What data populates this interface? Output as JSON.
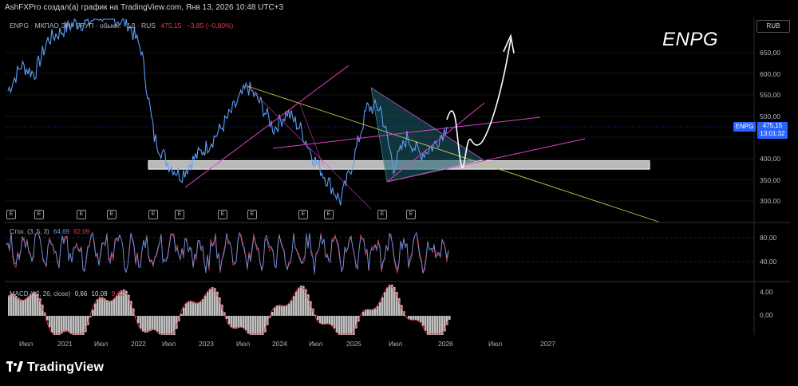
{
  "header": "AshFXPro создал(а) график на TradingView.com, Янв 13, 2026 10:48 UTC+3",
  "symbol_line": {
    "symbol": "ENPG · МКПАО ЭН+ ГРУП · обыкн. · 1Д · RUS",
    "price": "475,15",
    "change": "−3,85 (−0,80%)"
  },
  "big_title": "ENPG",
  "currency": "RUB",
  "price_label": {
    "symbol": "ENPG",
    "price": "475,15",
    "time": "13:01:32"
  },
  "stoch": {
    "name": "Стох. (3, 5, 3)",
    "k": "64,69",
    "d": "62,09",
    "ticks": [
      "80,00",
      "40,00"
    ]
  },
  "macd": {
    "name": "MACD (12, 26, close)",
    "v1": "0,66",
    "v2": "10,08",
    "v3": "9,42",
    "ticks": [
      "4,00",
      "0,00"
    ]
  },
  "earnings_badge": "E",
  "logo": "TradingView",
  "logo_icon": "tradingview-logo",
  "colors": {
    "price": "#5b9cf6",
    "magenta": "#e040c8",
    "yellow": "#c8c850",
    "triangle": "#1e5f6e",
    "stoch_k": "#5b9cf6",
    "stoch_d": "#f23645",
    "macd_hist": "#c0c0c0",
    "macd_line": "#f23645"
  },
  "chart_data": {
    "type": "line",
    "title": "",
    "y_axis_ticks": [
      "650,00",
      "600,00",
      "550,00",
      "500,00",
      "450,00",
      "400,00",
      "350,00",
      "300,00"
    ],
    "x_axis_ticks": [
      "Июл",
      "2021",
      "Июл",
      "2022",
      "Июл",
      "2023",
      "Июл",
      "2024",
      "Июл",
      "2025",
      "Июл",
      "2026",
      "Июл",
      "2027"
    ],
    "ylim": [
      260,
      700
    ],
    "series": [
      {
        "x": [
          "2020-07",
          "2020-09",
          "2020-11",
          "2021-01",
          "2021-03",
          "2021-05",
          "2021-07",
          "2021-09",
          "2021-11",
          "2022-01",
          "2022-03",
          "2022-05",
          "2022-07",
          "2022-09",
          "2022-11",
          "2023-01",
          "2023-03",
          "2023-05",
          "2023-07",
          "2023-09",
          "2023-11",
          "2024-01",
          "2024-03",
          "2024-05",
          "2024-07",
          "2024-09",
          "2024-11",
          "2025-01",
          "2025-03",
          "2025-05",
          "2025-07",
          "2025-09",
          "2025-11",
          "2026-01"
        ],
        "values": [
          560,
          620,
          600,
          680,
          700,
          720,
          720,
          740,
          730,
          720,
          660,
          450,
          390,
          360,
          400,
          430,
          470,
          520,
          570,
          530,
          470,
          510,
          470,
          400,
          350,
          300,
          400,
          520,
          520,
          380,
          450,
          410,
          430,
          475
        ]
      }
    ],
    "support_zone": [
      375,
      395
    ],
    "projection": {
      "from": "2026-01",
      "to": "2026-06",
      "target": "690,00"
    }
  }
}
